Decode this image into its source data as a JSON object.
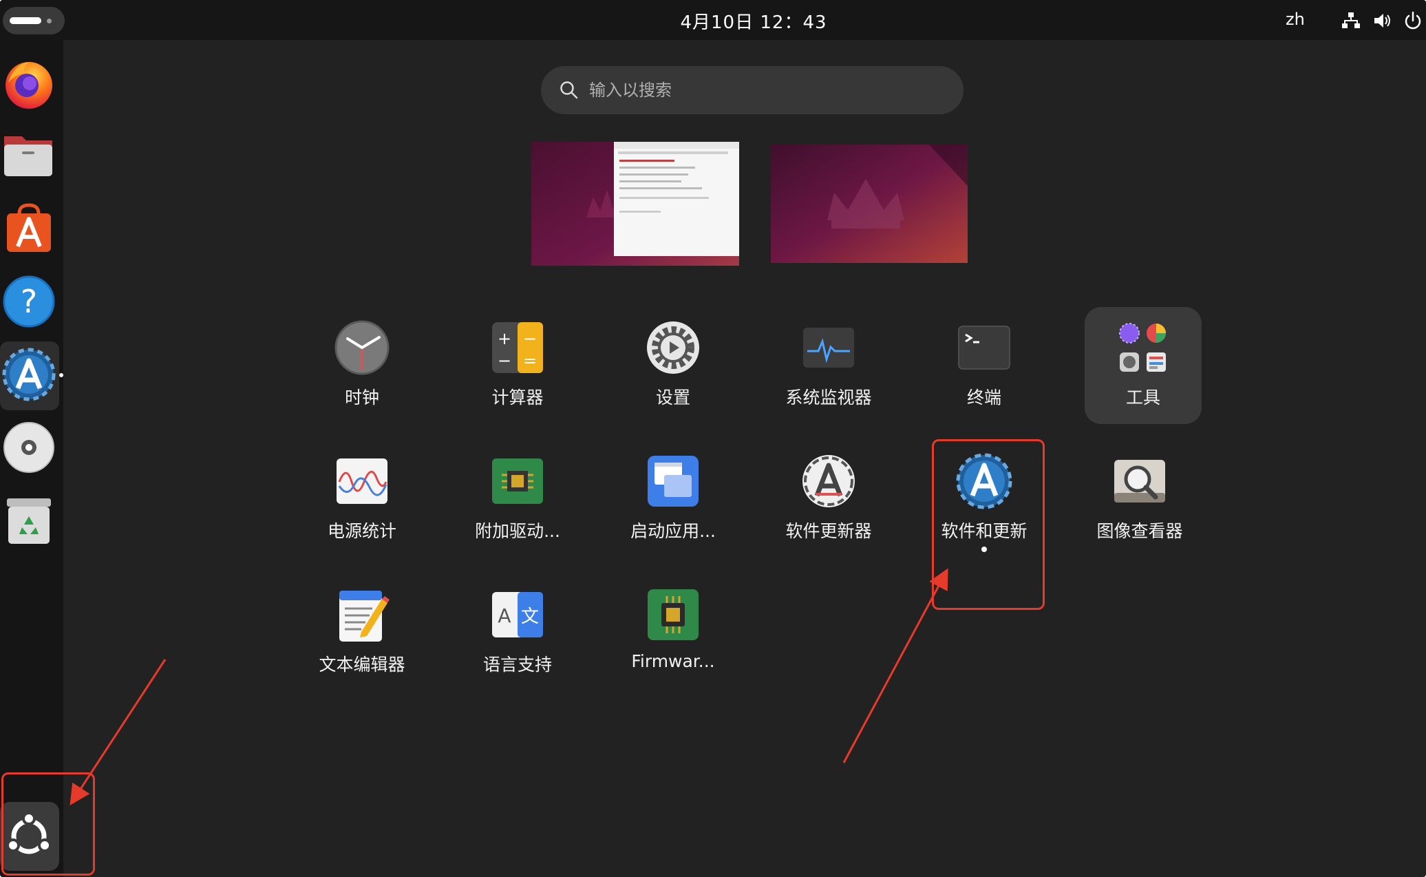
{
  "topbar": {
    "clock": "4月10日  12：43",
    "language": "zh"
  },
  "dock": {
    "items": [
      {
        "name": "firefox-icon"
      },
      {
        "name": "files-icon"
      },
      {
        "name": "app-center-icon"
      },
      {
        "name": "help-icon"
      },
      {
        "name": "software-updates-icon",
        "active": true
      },
      {
        "name": "disc-icon"
      },
      {
        "name": "trash-icon"
      }
    ],
    "show_apps_icon": "ubuntu-logo-icon"
  },
  "search": {
    "placeholder": "输入以搜索"
  },
  "apps": [
    {
      "label": "时钟",
      "icon": "clock-icon"
    },
    {
      "label": "计算器",
      "icon": "calculator-icon"
    },
    {
      "label": "设置",
      "icon": "settings-icon"
    },
    {
      "label": "系统监视器",
      "icon": "system-monitor-icon"
    },
    {
      "label": "终端",
      "icon": "terminal-icon"
    },
    {
      "label": "工具",
      "icon": "folder-icon"
    },
    {
      "label": "电源统计",
      "icon": "power-statistics-icon"
    },
    {
      "label": "附加驱动...",
      "icon": "additional-drivers-icon"
    },
    {
      "label": "启动应用...",
      "icon": "startup-apps-icon"
    },
    {
      "label": "软件更新器",
      "icon": "software-updater-icon"
    },
    {
      "label": "软件和更新",
      "icon": "software-and-updates-icon"
    },
    {
      "label": "图像查看器",
      "icon": "image-viewer-icon"
    },
    {
      "label": "文本编辑器",
      "icon": "text-editor-icon"
    },
    {
      "label": "语言支持",
      "icon": "language-support-icon"
    },
    {
      "label": "Firmwar...",
      "icon": "firmware-icon"
    }
  ],
  "colors": {
    "annotation": "#e63a2a",
    "background": "#222222",
    "dock": "#151515"
  }
}
